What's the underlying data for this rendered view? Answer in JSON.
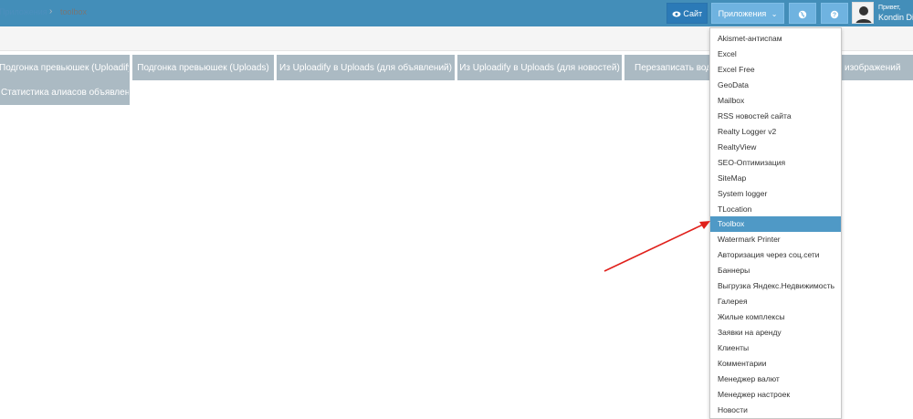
{
  "header": {
    "site_label": "Сайт",
    "apps_label": "Приложения",
    "greeting": "Привет,",
    "username": "Kondin Di"
  },
  "breadcrumbs": {
    "parent": "Приложения",
    "current": "toolbox"
  },
  "tabs": [
    "Подгонка превьюшек (Uploadify)",
    "Подгонка превьюшек (Uploads)",
    "Из Uploadify в Uploads (для объявлений)",
    "Из Uploadify в Uploads (для новостей)",
    "Перезаписать вод",
    "изображений",
    "Статистика алиасов объявлений"
  ],
  "dropdown": {
    "items": [
      "Akismet-антиспам",
      "Excel",
      "Excel Free",
      "GeoData",
      "Mailbox",
      "RSS новостей сайта",
      "Realty Logger v2",
      "RealtyView",
      "SEO-Оптимизация",
      "SiteMap",
      "System logger",
      "TLocation",
      "Toolbox",
      "Watermark Printer",
      "Авторизация через соц.сети",
      "Баннеры",
      "Выгрузка Яндекс.Недвижимость",
      "Галерея",
      "Жилые комплексы",
      "Заявки на аренду",
      "Клиенты",
      "Комментарии",
      "Менеджер валют",
      "Менеджер настроек",
      "Новости"
    ],
    "active_item": "Toolbox"
  },
  "colors": {
    "topbar": "#438eb9",
    "tab": "#abbac3",
    "active_item": "#4f99c6",
    "arrow": "#e0201b"
  }
}
